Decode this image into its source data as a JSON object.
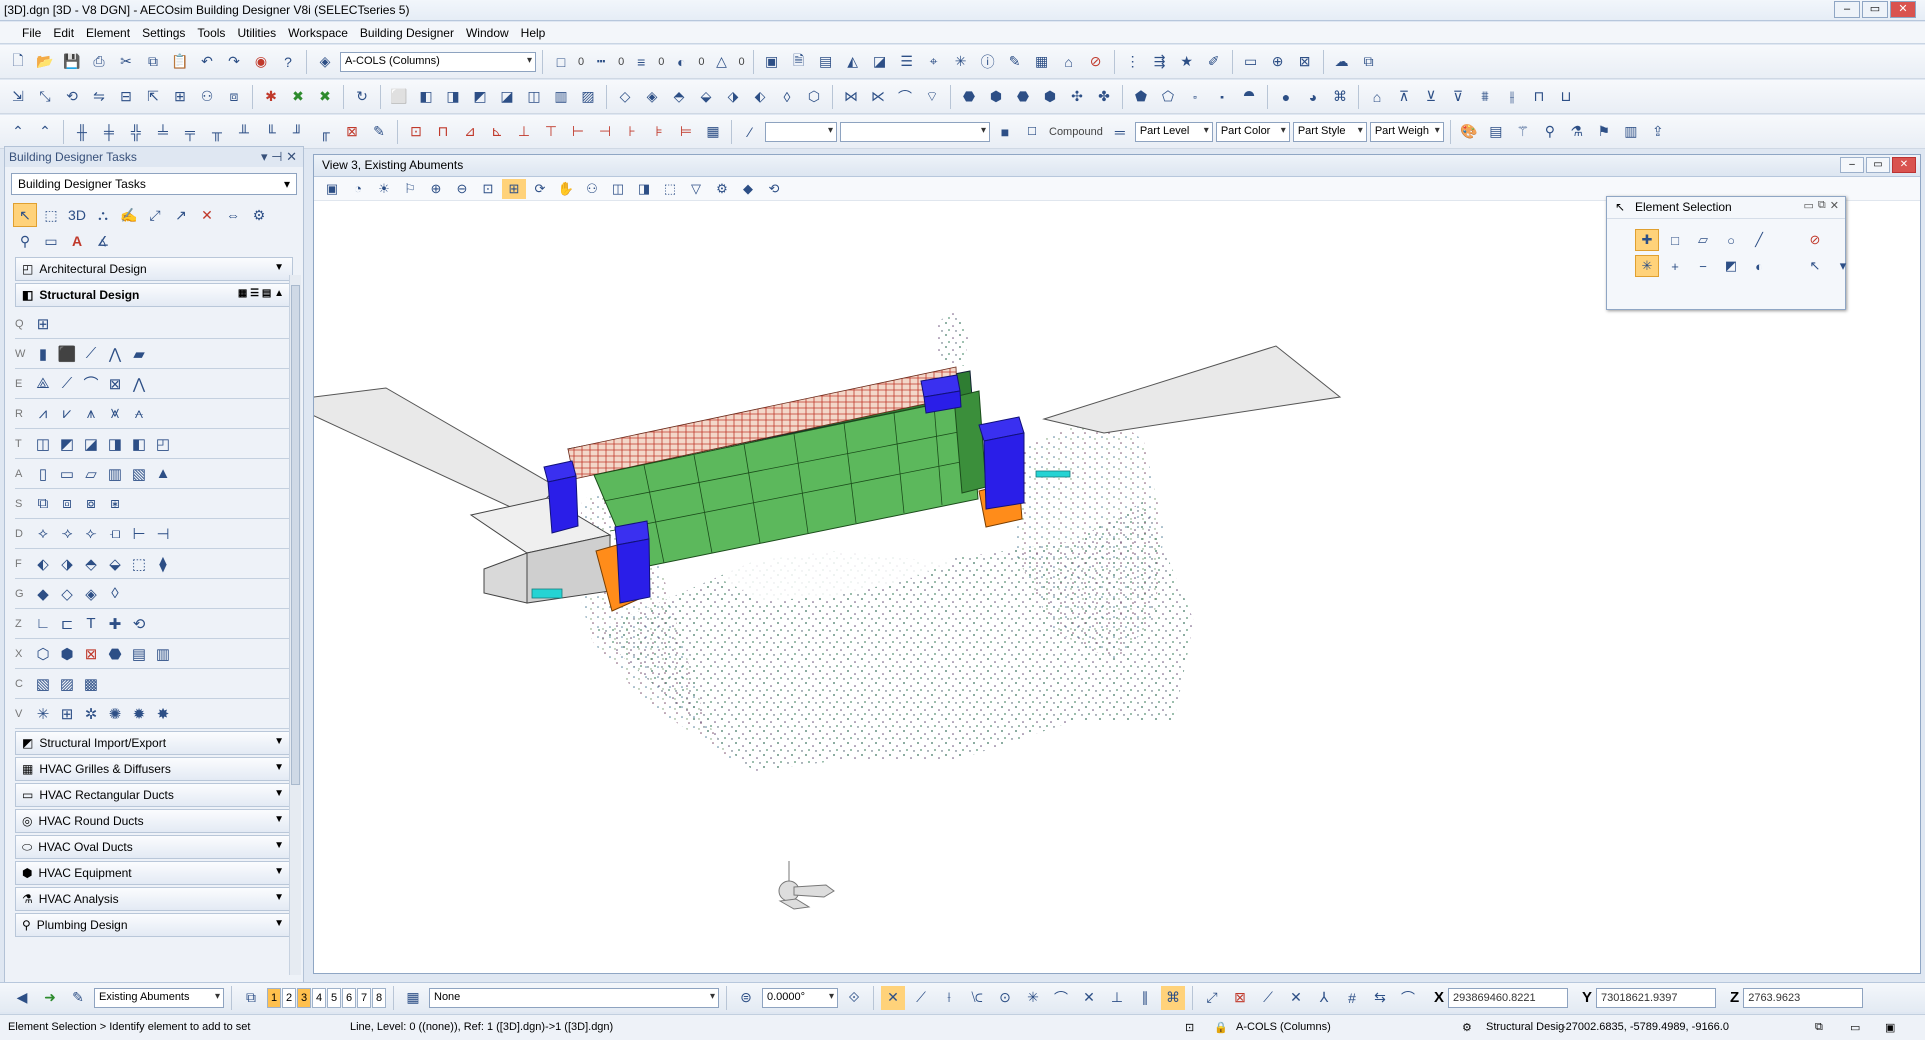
{
  "window": {
    "title": "[3D].dgn [3D - V8 DGN] - AECOsim Building Designer V8i (SELECTseries 5)",
    "controls": [
      "–",
      "▭",
      "✕"
    ]
  },
  "menu": [
    "File",
    "Edit",
    "Element",
    "Settings",
    "Tools",
    "Utilities",
    "Workspace",
    "Building Designer",
    "Window",
    "Help"
  ],
  "toolbar1": {
    "level_combo": "A-COLS (Columns)",
    "color_value": "0",
    "style_value": "0",
    "weight_value": "0",
    "transparency_value": "0",
    "priority_value": "0"
  },
  "toolbar3": {
    "compound_label": "Compound",
    "part_level": "Part Level",
    "part_color": "Part Color",
    "part_style": "Part Style",
    "part_weight": "Part Weigh"
  },
  "tasks": {
    "panel_title": "Building Designer Tasks",
    "combo_value": "Building Designer Tasks",
    "groups_before": [
      "Architectural Design"
    ],
    "open_group": "Structural Design",
    "row_keys": [
      "Q",
      "W",
      "E",
      "R",
      "T",
      "A",
      "S",
      "D",
      "F",
      "G",
      "Z",
      "X",
      "C",
      "V"
    ],
    "groups_after": [
      "Structural Import/Export",
      "HVAC Grilles & Diffusers",
      "HVAC Rectangular Ducts",
      "HVAC Round Ducts",
      "HVAC Oval Ducts",
      "HVAC Equipment",
      "HVAC Analysis",
      "Plumbing Design"
    ]
  },
  "view": {
    "title": "View 3, Existing Abuments"
  },
  "element_selection": {
    "title": "Element Selection"
  },
  "bottom": {
    "saved_view": "Existing Abuments",
    "view_numbers": [
      "1",
      "2",
      "3",
      "4",
      "5",
      "6",
      "7",
      "8"
    ],
    "active_views": [
      "1",
      "3"
    ],
    "display_style": "None",
    "angle": "0.0000°",
    "x_label": "X",
    "x_value": "293869460.8221",
    "y_label": "Y",
    "y_value": "73018621.9397",
    "z_label": "Z",
    "z_value": "2763.9623"
  },
  "status": {
    "prompt": "Element Selection > Identify element to add to set",
    "info": "Line, Level: 0 ((none)), Ref: 1 ([3D].dgn)->1 ([3D].dgn)",
    "active_level": "A-COLS (Columns)",
    "structural": "Structural Desig",
    "coords": "-27002.6835, -5789.4989, -9166.0"
  },
  "colors": {
    "beam_green": "#5cb85c",
    "column_blue": "#2a1ee8",
    "footing_orange": "#ff8c1a",
    "accent_highlight": "#ffc04d"
  }
}
